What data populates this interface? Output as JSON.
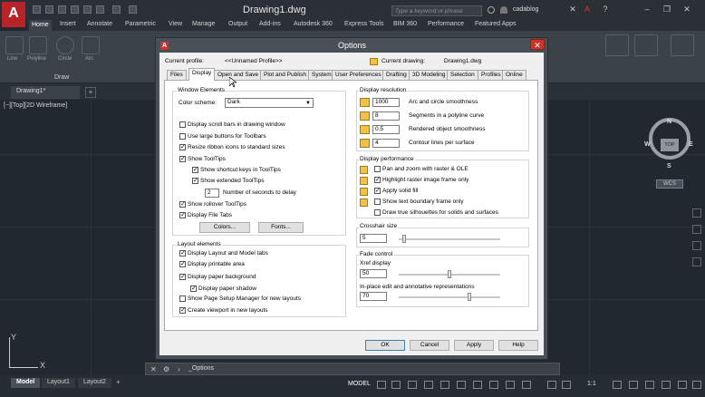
{
  "app": {
    "logo": "A",
    "doc_title": "Drawing1.dwg",
    "search_placeholder": "Type a keyword or phrase",
    "user": "cadablog",
    "help": "?"
  },
  "ribbon": {
    "tabs": [
      "Home",
      "Insert",
      "Annotate",
      "Parametric",
      "View",
      "Manage",
      "Output",
      "Add-ins",
      "Autodesk 360",
      "Express Tools",
      "BIM 360",
      "Performance",
      "Featured Apps"
    ],
    "panel_draw_label": "Draw",
    "tools": [
      "Line",
      "Polyline",
      "Circle",
      "Arc"
    ]
  },
  "doc_tab": {
    "label": "Drawing1*",
    "add": "+"
  },
  "viewport_label": "[−][Top][2D Wireframe]",
  "compass": {
    "n": "N",
    "s": "S",
    "e": "E",
    "w": "W",
    "top": "TOP",
    "wcs": "WCS"
  },
  "command_line": {
    "text": "_Options"
  },
  "layout_tabs": [
    "Model",
    "Layout1",
    "Layout2"
  ],
  "status": {
    "model": "MODEL",
    "scale": "1:1"
  },
  "dialog": {
    "title": "Options",
    "close": "✕",
    "current_profile_label": "Current profile:",
    "current_profile_value": "<<Unnamed Profile>>",
    "current_drawing_label": "Current drawing:",
    "current_drawing_value": "Drawing1.dwg",
    "tabs": [
      "Files",
      "Display",
      "Open and Save",
      "Plot and Publish",
      "System",
      "User Preferences",
      "Drafting",
      "3D Modeling",
      "Selection",
      "Profiles",
      "Online"
    ],
    "window_elements": {
      "title": "Window Elements",
      "color_scheme_label": "Color scheme:",
      "color_scheme_value": "Dark",
      "scroll_bars": "Display scroll bars in drawing window",
      "large_buttons": "Use large buttons for Toolbars",
      "resize_ribbon": "Resize ribbon icons to standard sizes",
      "show_tooltips": "Show ToolTips",
      "shortcut_keys": "Show shortcut keys in ToolTips",
      "extended_tooltips": "Show extended ToolTips",
      "seconds_value": "2",
      "seconds_label": "Number of seconds to delay",
      "rollover": "Show rollover ToolTips",
      "file_tabs": "Display File Tabs",
      "colors_btn": "Colors...",
      "fonts_btn": "Fonts..."
    },
    "layout_elements": {
      "title": "Layout elements",
      "layout_model_tabs": "Display Layout and Model tabs",
      "printable_area": "Display printable area",
      "paper_background": "Display paper background",
      "paper_shadow": "Display paper shadow",
      "page_setup": "Show Page Setup Manager for new layouts",
      "create_viewport": "Create viewport in new layouts"
    },
    "display_resolution": {
      "title": "Display resolution",
      "arc_value": "1000",
      "arc_label": "Arc and circle smoothness",
      "polyline_value": "8",
      "polyline_label": "Segments in a polyline curve",
      "rendered_value": "0.5",
      "rendered_label": "Rendered object smoothness",
      "contour_value": "4",
      "contour_label": "Contour lines per surface"
    },
    "display_performance": {
      "title": "Display performance",
      "pan_zoom": "Pan and zoom with raster & OLE",
      "highlight_raster": "Highlight raster image frame only",
      "solid_fill": "Apply solid fill",
      "text_boundary": "Show text boundary frame only",
      "true_silhouettes": "Draw true silhouettes for solids and surfaces"
    },
    "crosshair": {
      "title": "Crosshair size",
      "value": "5",
      "level": 0.05
    },
    "fade_control": {
      "title": "Fade control",
      "xref_label": "Xref display",
      "xref_value": "50",
      "xref_level": 0.5,
      "inplace_label": "In-place edit and annotative representations",
      "inplace_value": "70",
      "inplace_level": 0.7
    },
    "buttons": {
      "ok": "OK",
      "cancel": "Cancel",
      "apply": "Apply",
      "help": "Help"
    }
  }
}
